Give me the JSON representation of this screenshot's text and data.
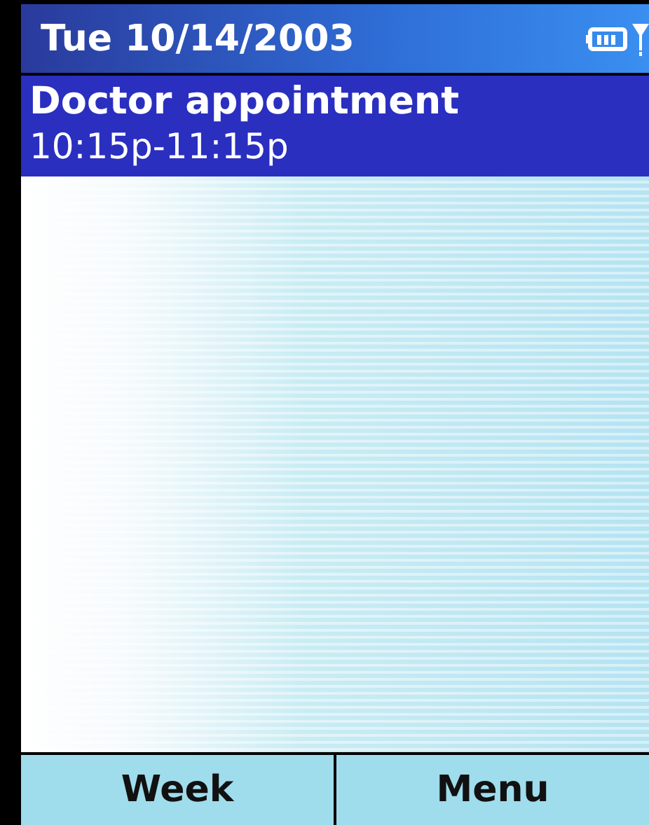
{
  "title_bar": {
    "date": "Tue 10/14/2003"
  },
  "appointments": [
    {
      "title": "Doctor appointment",
      "time": "10:15p-11:15p",
      "selected": true
    }
  ],
  "softkeys": [
    "Week",
    "Menu"
  ]
}
